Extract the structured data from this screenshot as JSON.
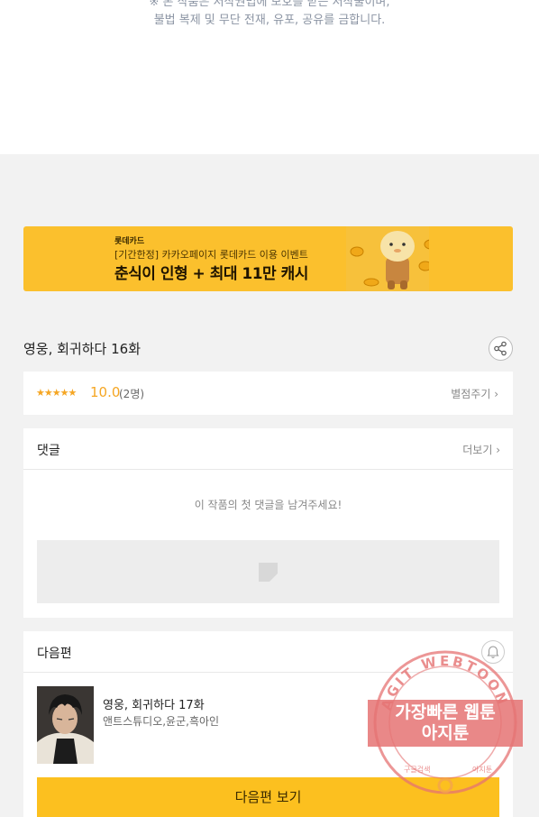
{
  "notice": {
    "line1": "※ 본 작품은 저작권법에 보호를 받는 저작물이며,",
    "line2": "불법 복제 및 무단 전재, 유포, 공유를 금합니다."
  },
  "banner": {
    "brand": "롯데카드",
    "subtitle": "[기간한정] 카카오페이지 롯데카드 이용 이벤트",
    "title": "춘식이 인형 + 최대 11만 캐시"
  },
  "episode": {
    "title": "영웅, 회귀하다 16화"
  },
  "rating": {
    "stars": "★★★★★",
    "score": "10.0",
    "count": "(2명)",
    "action": "별점주기 ›"
  },
  "comments": {
    "title": "댓글",
    "more": "더보기 ›",
    "empty_message": "이 작품의 첫 댓글을 남겨주세요!"
  },
  "next": {
    "section_title": "다음편",
    "episode_title": "영웅, 회귀하다 17화",
    "authors": "앤트스튜디오,윤군,흑아인",
    "button_label": "다음편 보기"
  },
  "watermark": {
    "ring_text": "AGIT WEBTOON",
    "line1": "가장빠른 웹툰",
    "line2": "아지툰",
    "bottom_left": "구글검색",
    "bottom_right": "아지툰"
  },
  "colors": {
    "accent": "#fcc01f",
    "star": "#f5a623",
    "banner_bg": "#fbc02d",
    "watermark_red": "#e53935"
  },
  "icons": {
    "share": "share-icon",
    "bell": "bell-icon",
    "ad_placeholder": "image-placeholder-icon"
  }
}
